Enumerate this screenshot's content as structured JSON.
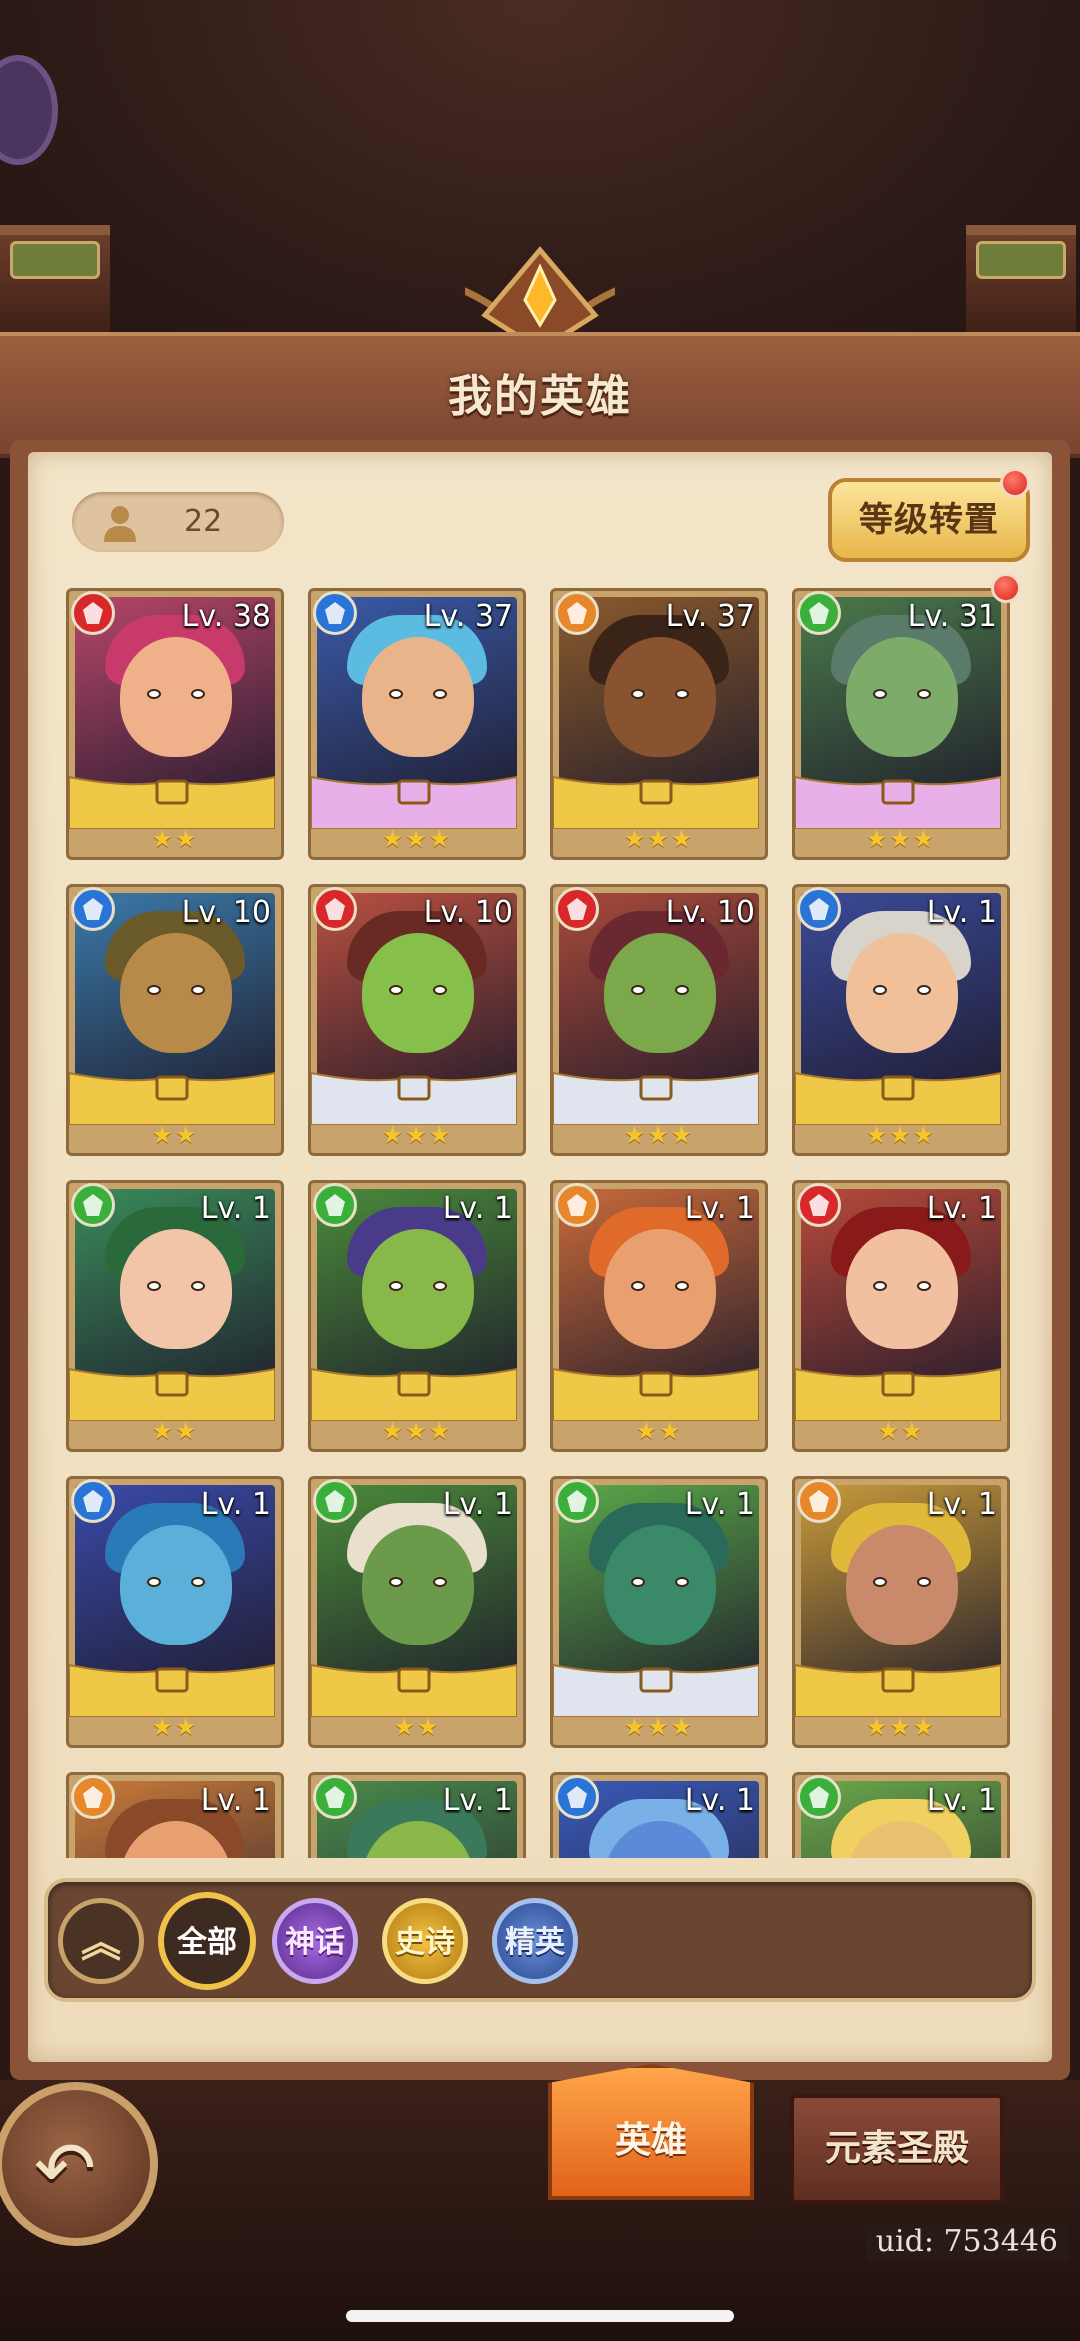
{
  "title": "我的英雄",
  "hero_count": "22",
  "level_reset_label": "等级转置",
  "heroes": [
    {
      "level": "Lv. 38",
      "element": "fire",
      "stars": "★★",
      "bg": "#b7466a",
      "skin": "#f0b08a",
      "hair": "#c83a6a",
      "frame": "gold"
    },
    {
      "level": "Lv. 37",
      "element": "water",
      "stars": "★★★",
      "bg": "#3a5aa8",
      "skin": "#e9b48a",
      "hair": "#5bbbe0",
      "frame": "pink"
    },
    {
      "level": "Lv. 37",
      "element": "light",
      "stars": "★★★",
      "bg": "#8a5a2c",
      "skin": "#8a5330",
      "hair": "#3a2418",
      "frame": "gold"
    },
    {
      "level": "Lv. 31",
      "element": "wind",
      "stars": "★★★",
      "bg": "#4a7a4a",
      "skin": "#7dab6a",
      "hair": "#5a7a6a",
      "frame": "pink"
    },
    {
      "level": "Lv. 10",
      "element": "water",
      "stars": "★★",
      "bg": "#3a7aa8",
      "skin": "#b88a4a",
      "hair": "#6a5a2a",
      "frame": "gold"
    },
    {
      "level": "Lv. 10",
      "element": "fire",
      "stars": "★★★",
      "bg": "#b85040",
      "skin": "#86c04a",
      "hair": "#6a2a24",
      "frame": "silver"
    },
    {
      "level": "Lv. 10",
      "element": "fire",
      "stars": "★★★",
      "bg": "#a84a3a",
      "skin": "#7aa84a",
      "hair": "#6a2830",
      "frame": "silver"
    },
    {
      "level": "Lv. 1",
      "element": "water",
      "stars": "★★★",
      "bg": "#3a4a98",
      "skin": "#f0c09a",
      "hair": "#d8d4cc",
      "frame": "gold"
    },
    {
      "level": "Lv. 1",
      "element": "wind",
      "stars": "★★",
      "bg": "#3a8a5a",
      "skin": "#f2c4a8",
      "hair": "#2a6a3a",
      "frame": "gold"
    },
    {
      "level": "Lv. 1",
      "element": "wind",
      "stars": "★★★",
      "bg": "#4a8a3a",
      "skin": "#88b84a",
      "hair": "#4a3a8a",
      "frame": "gold"
    },
    {
      "level": "Lv. 1",
      "element": "light",
      "stars": "★★",
      "bg": "#c86a3a",
      "skin": "#e8a070",
      "hair": "#e06a2a",
      "frame": "gold"
    },
    {
      "level": "Lv. 1",
      "element": "fire",
      "stars": "★★",
      "bg": "#b84a3a",
      "skin": "#f2c0a0",
      "hair": "#8a1a1a",
      "frame": "gold"
    },
    {
      "level": "Lv. 1",
      "element": "water",
      "stars": "★★",
      "bg": "#3a4aa8",
      "skin": "#5ab0d8",
      "hair": "#2a7ab8",
      "frame": "gold"
    },
    {
      "level": "Lv. 1",
      "element": "wind",
      "stars": "★★",
      "bg": "#4a8a3a",
      "skin": "#6a9a4a",
      "hair": "#e8e0cc",
      "frame": "gold"
    },
    {
      "level": "Lv. 1",
      "element": "wind",
      "stars": "★★★",
      "bg": "#5aa84a",
      "skin": "#3a8a6a",
      "hair": "#2a6a5a",
      "frame": "silver"
    },
    {
      "level": "Lv. 1",
      "element": "light",
      "stars": "★★★",
      "bg": "#c89a3a",
      "skin": "#c88a6a",
      "hair": "#e0b83a",
      "frame": "gold"
    },
    {
      "level": "Lv. 1",
      "element": "light",
      "stars": "★★",
      "bg": "#c87a3a",
      "skin": "#e8a070",
      "hair": "#8a4a2a",
      "frame": "gold"
    },
    {
      "level": "Lv. 1",
      "element": "wind",
      "stars": "★★",
      "bg": "#4a8a4a",
      "skin": "#8ab84a",
      "hair": "#3a7a5a",
      "frame": "gold"
    },
    {
      "level": "Lv. 1",
      "element": "water",
      "stars": "★★",
      "bg": "#3a5ab8",
      "skin": "#5a8ad8",
      "hair": "#7ab0e8",
      "frame": "gold"
    },
    {
      "level": "Lv. 1",
      "element": "wind",
      "stars": "★★",
      "bg": "#6aa84a",
      "skin": "#e8c070",
      "hair": "#f0d060",
      "frame": "gold"
    }
  ],
  "filters": {
    "collapse_icon": "chevron-double-up-icon",
    "all_label": "全部",
    "mythic_label": "神话",
    "epic_label": "史诗",
    "elite_label": "精英"
  },
  "tabs": {
    "heroes_label": "英雄",
    "temple_label": "元素圣殿"
  },
  "uid_text": "uid: 753446",
  "element_colors": {
    "fire": "#d8282a",
    "water": "#2a74d8",
    "light": "#e8862a",
    "wind": "#3ab03a"
  },
  "notification_dots": [
    "level-reset-button",
    "hero-4"
  ]
}
